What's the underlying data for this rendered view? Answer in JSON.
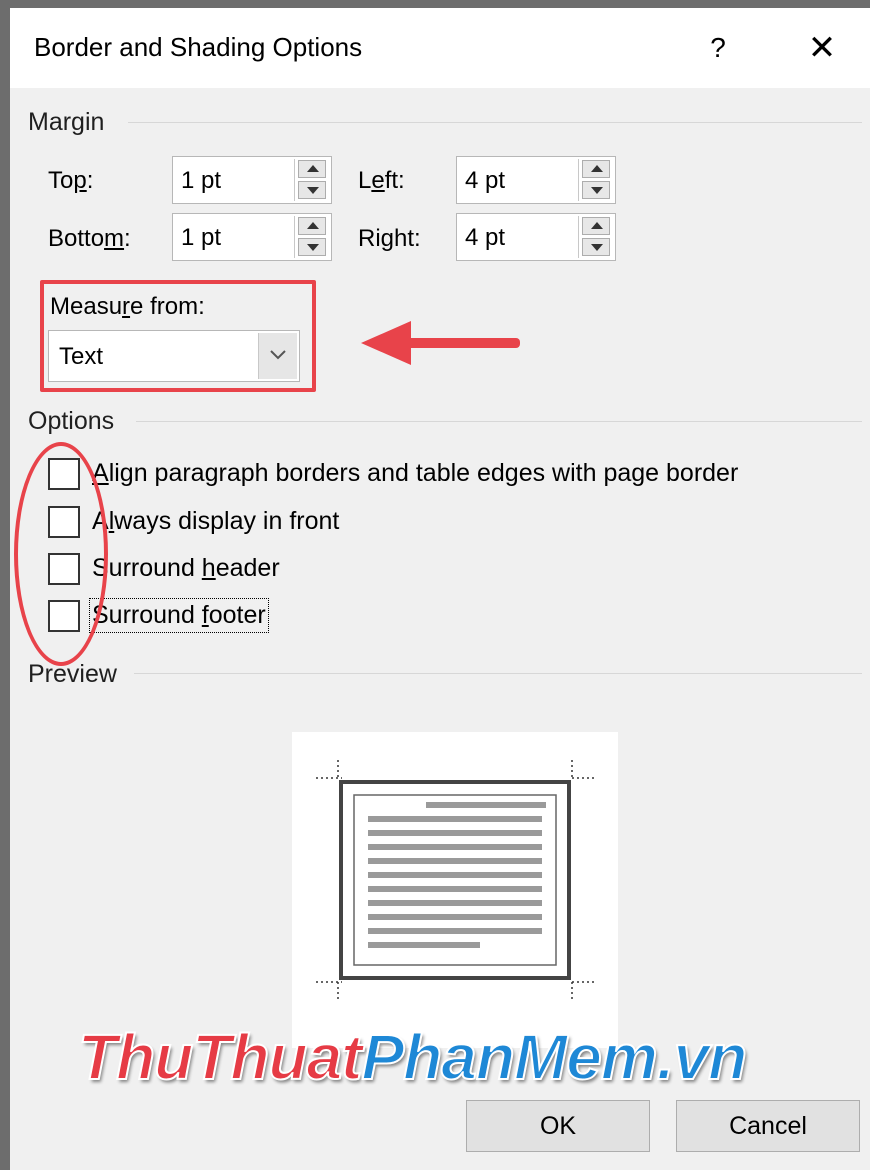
{
  "dialog": {
    "title": "Border and Shading Options",
    "help_label": "?",
    "close_label": "✕"
  },
  "margin": {
    "section_label": "Margin",
    "top": {
      "label_pre": "To",
      "label_underlined": "p",
      "label_post": ":",
      "value": "1 pt"
    },
    "bottom": {
      "label_pre": "Botto",
      "label_underlined": "m",
      "label_post": ":",
      "value": "1 pt"
    },
    "left": {
      "label_pre": "L",
      "label_underlined": "e",
      "label_post": "ft:",
      "value": "4 pt"
    },
    "right": {
      "label_pre": "Ri",
      "label_underlined": "g",
      "label_post": "ht:",
      "value": "4 pt"
    }
  },
  "measure_from": {
    "label_pre": "Measu",
    "label_underlined": "r",
    "label_post": "e from:",
    "selected": "Text"
  },
  "options": {
    "section_label": "Options",
    "items": [
      {
        "pre": "",
        "underlined": "A",
        "post": "lign paragraph borders and table edges with page border",
        "checked": false
      },
      {
        "pre": "A",
        "underlined": "l",
        "post": "ways display in front",
        "checked": false
      },
      {
        "pre": "Surround ",
        "underlined": "h",
        "post": "eader",
        "checked": false
      },
      {
        "pre": "Surround ",
        "underlined": "f",
        "post": "ooter",
        "checked": false
      }
    ]
  },
  "preview": {
    "section_label": "Preview"
  },
  "watermark": {
    "part1": "ThuThuat",
    "part2": "PhanMem.vn"
  },
  "buttons": {
    "ok": "OK",
    "cancel": "Cancel"
  },
  "colors": {
    "highlight": "#e8434a",
    "watermark_red": "#e63b45",
    "watermark_blue": "#1e88d6"
  },
  "icons": {
    "help": "question-mark",
    "close": "x-close",
    "dropdown": "chevron-down",
    "spin": "up-down-arrows"
  }
}
